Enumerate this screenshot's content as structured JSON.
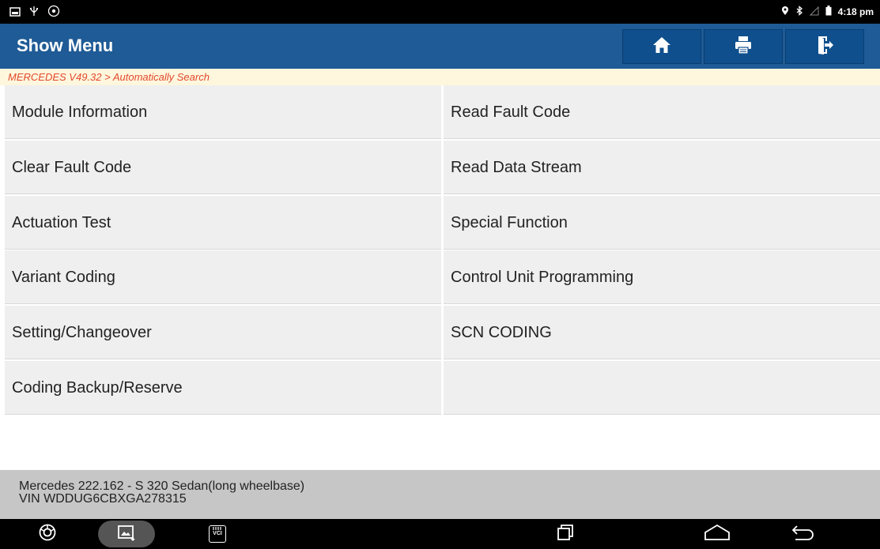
{
  "status_bar": {
    "time": "4:18 pm",
    "left_icons": [
      "gallery-icon",
      "usb-icon",
      "settings-badge-icon"
    ],
    "right_icons": [
      "location-icon",
      "bluetooth-icon",
      "signal-icon",
      "battery-icon"
    ]
  },
  "header": {
    "title": "Show Menu",
    "buttons": [
      {
        "name": "home",
        "icon": "home-icon"
      },
      {
        "name": "print",
        "icon": "printer-icon"
      },
      {
        "name": "exit",
        "icon": "exit-icon"
      }
    ]
  },
  "breadcrumb": "MERCEDES V49.32 > Automatically Search",
  "menu": {
    "items": [
      {
        "label": "Module Information"
      },
      {
        "label": "Read Fault Code"
      },
      {
        "label": "Clear Fault Code"
      },
      {
        "label": "Read Data Stream"
      },
      {
        "label": "Actuation Test"
      },
      {
        "label": "Special Function"
      },
      {
        "label": "Variant Coding"
      },
      {
        "label": "Control Unit Programming"
      },
      {
        "label": "Setting/Changeover"
      },
      {
        "label": "SCN CODING"
      },
      {
        "label": "Coding Backup/Reserve"
      },
      {
        "label": ""
      }
    ]
  },
  "vehicle": {
    "model": "Mercedes 222.162 - S 320 Sedan(long wheelbase)",
    "vin": "VIN WDDUG6CBXGA278315"
  },
  "nav_bar": {
    "vci_label": "VCI",
    "icons": [
      "browser-icon",
      "screenshot-icon",
      "vci-icon",
      "recent-apps-icon",
      "home-nav-icon",
      "back-icon"
    ]
  },
  "colors": {
    "header_bg": "#1f5b96",
    "button_bg": "#0f4f8d",
    "breadcrumb_text": "#e2482d",
    "breadcrumb_bg": "#fff7dd",
    "cell_bg": "#efefef",
    "info_bg": "#c6c6c6"
  }
}
